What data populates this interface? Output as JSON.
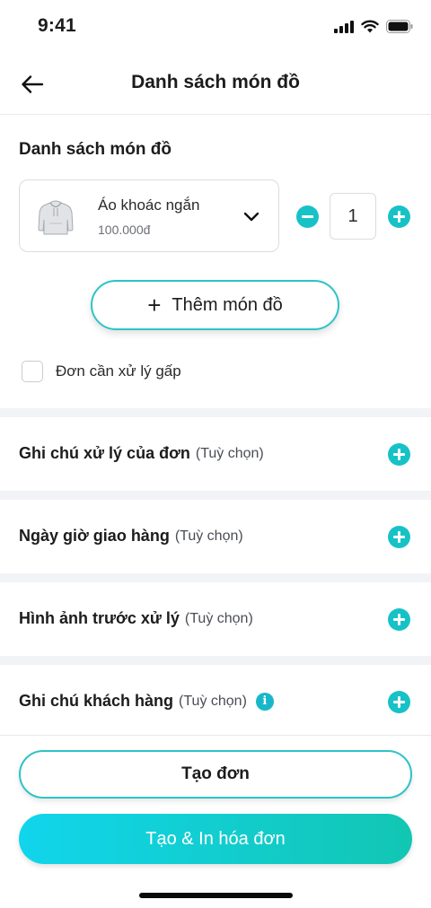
{
  "status_bar": {
    "time": "9:41"
  },
  "header": {
    "title": "Danh sách món đồ"
  },
  "items_section": {
    "title": "Danh sách món đồ"
  },
  "item": {
    "name": "Áo khoác ngắn",
    "price": "100.000đ",
    "quantity": "1"
  },
  "add_item": {
    "plus": "+",
    "label": "Thêm món đồ"
  },
  "urgent": {
    "label": "Đơn cần xử lý gấp",
    "checked": false
  },
  "options": [
    {
      "label": "Ghi chú xử lý của đơn",
      "optional": "(Tuỳ chọn)"
    },
    {
      "label": "Ngày giờ giao hàng",
      "optional": "(Tuỳ chọn)"
    },
    {
      "label": "Hình ảnh trước xử lý",
      "optional": "(Tuỳ chọn)"
    },
    {
      "label": "Ghi chú khách hàng",
      "optional": "(Tuỳ chọn)",
      "info_icon": "info-icon",
      "info_glyph": "i"
    }
  ],
  "actions": {
    "create": "Tạo đơn",
    "create_print": "Tạo & In hóa đơn"
  },
  "colors": {
    "accent": "#17c2c7",
    "gradient_start": "#11d5ec",
    "gradient_end": "#12c6b3"
  }
}
